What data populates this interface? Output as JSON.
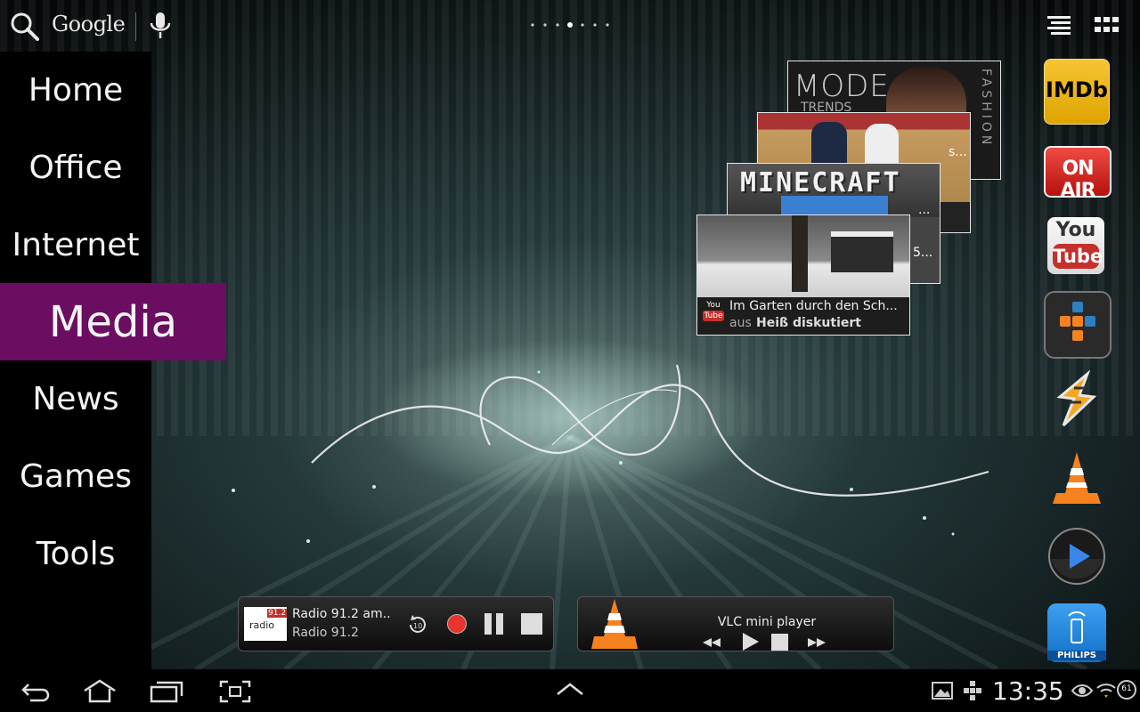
{
  "search": {
    "label": "Google"
  },
  "sidebar": {
    "items": [
      {
        "label": "Home"
      },
      {
        "label": "Office"
      },
      {
        "label": "Internet"
      },
      {
        "label": "Media",
        "active": true
      },
      {
        "label": "News"
      },
      {
        "label": "Games"
      },
      {
        "label": "Tools"
      }
    ]
  },
  "youtube_widget": {
    "cards": [
      {
        "title": "MODE",
        "subtitle": "TRENDS",
        "side": "FASHION"
      },
      {
        "title": "s..."
      },
      {
        "title": "MINECRAFT",
        "badge": "..."
      },
      {
        "title": "5..."
      },
      {
        "title": "Im Garten durch den Sch...",
        "source_prefix": "aus",
        "source_name": "Heiß diskutiert"
      }
    ]
  },
  "dock": {
    "imdb_label": "IMDb",
    "onair_label": "ON AIR",
    "youtube_top": "You",
    "youtube_bottom": "Tube",
    "philips_label": "PHILIPS"
  },
  "radio_widget": {
    "logo_number": "91.2",
    "logo_text": "radio",
    "title": "Radio 91.2 am..",
    "station": "Radio 91.2",
    "rewind_label": "10"
  },
  "vlc_widget": {
    "title": "VLC mini player"
  },
  "status_bar": {
    "time": "13:35",
    "battery": "61"
  },
  "colors": {
    "active_category": "#6b0e61",
    "record_red": "#e8342c"
  }
}
